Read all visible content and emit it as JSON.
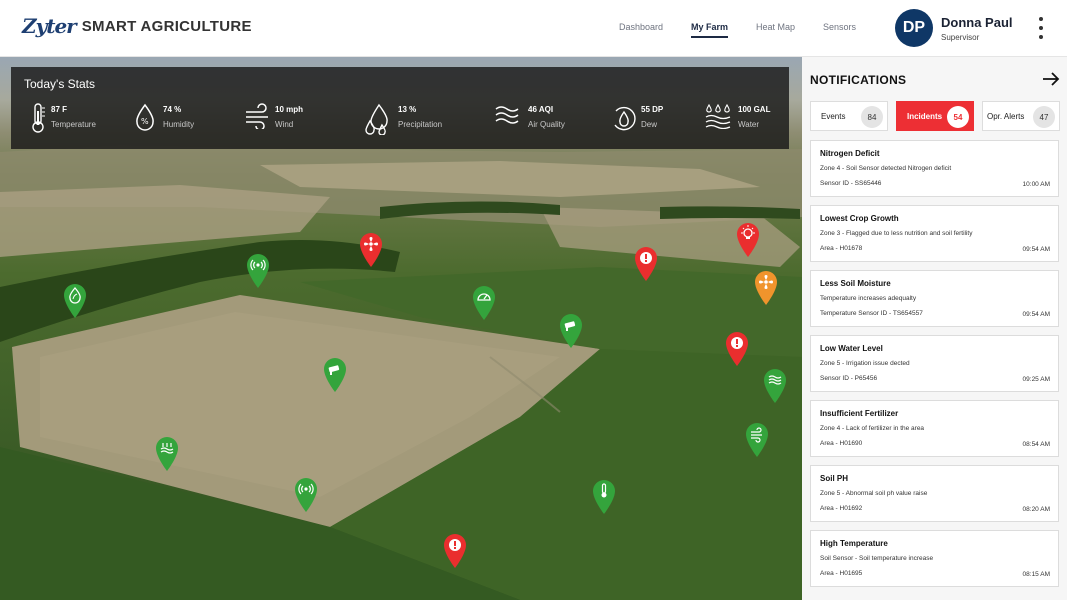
{
  "header": {
    "logo_mark": "Zyter",
    "app_title": "SMART AGRICULTURE",
    "nav": [
      "Dashboard",
      "My Farm",
      "Heat Map",
      "Sensors"
    ],
    "active_nav": "My Farm",
    "user": {
      "initials": "DP",
      "name": "Donna Paul",
      "role": "Supervisor"
    }
  },
  "stats": {
    "title": "Today's Stats",
    "items": [
      {
        "value": "87 F",
        "label": "Temperature",
        "icon": "thermometer-icon"
      },
      {
        "value": "74 %",
        "label": "Humidity",
        "icon": "humidity-drop-icon"
      },
      {
        "value": "10 mph",
        "label": "Wind",
        "icon": "wind-icon"
      },
      {
        "value": "13 %",
        "label": "Precipitation",
        "icon": "rain-drops-icon"
      },
      {
        "value": "46 AQI",
        "label": "Air Quality",
        "icon": "air-waves-icon"
      },
      {
        "value": "55 DP",
        "label": "Dew",
        "icon": "dew-icon"
      },
      {
        "value": "100 GAL",
        "label": "Water",
        "icon": "water-icon"
      }
    ]
  },
  "map_pins": [
    {
      "icon": "leaf-drop-icon",
      "color": "#34a43c"
    },
    {
      "icon": "signal-icon",
      "color": "#34a43c"
    },
    {
      "icon": "fan-icon",
      "color": "#ea2e2e"
    },
    {
      "icon": "alert-icon",
      "color": "#ea2e2e"
    },
    {
      "icon": "bulb-icon",
      "color": "#ea2e2e"
    },
    {
      "icon": "gauge-icon",
      "color": "#34a43c"
    },
    {
      "icon": "fan-icon",
      "color": "#f0942c"
    },
    {
      "icon": "camera-icon",
      "color": "#34a43c"
    },
    {
      "icon": "alert-icon",
      "color": "#ea2e2e"
    },
    {
      "icon": "camera-icon",
      "color": "#34a43c"
    },
    {
      "icon": "waves-icon",
      "color": "#34a43c"
    },
    {
      "icon": "wind-icon",
      "color": "#34a43c"
    },
    {
      "icon": "heater-icon",
      "color": "#34a43c"
    },
    {
      "icon": "signal-icon",
      "color": "#34a43c"
    },
    {
      "icon": "thermometer-icon",
      "color": "#34a43c"
    },
    {
      "icon": "alert-icon",
      "color": "#ea2e2e"
    }
  ],
  "notifications": {
    "title": "NOTIFICATIONS",
    "tabs": [
      {
        "label": "Events",
        "count": "84"
      },
      {
        "label": "Incidents",
        "count": "54"
      },
      {
        "label": "Opr. Alerts",
        "count": "47"
      }
    ],
    "active_tab": "Incidents",
    "items": [
      {
        "title": "Nitrogen Deficit",
        "desc": "Zone 4  - Soil Sensor detected Nitrogen deficit",
        "source": "Sensor ID - SS65446",
        "time": "10:00 AM"
      },
      {
        "title": "Lowest Crop Growth",
        "desc": "Zone 3 - Flagged due to less nutrition and soil fertility",
        "source": "Area -  H01678",
        "time": "09:54 AM"
      },
      {
        "title": "Less Soil Moisture",
        "desc": "Temperature increases adequalty",
        "source": "Temperature Sensor ID - TS654557",
        "time": "09:54 AM"
      },
      {
        "title": "Low Water Level",
        "desc": "Zone 5 - Irrigation issue dected",
        "source": "Sensor ID - P65456",
        "time": "09:25 AM"
      },
      {
        "title": "Insufficient Fertilizer",
        "desc": "Zone 4 - Lack of fertilizer in the area",
        "source": "Area - H01690",
        "time": "08:54 AM"
      },
      {
        "title": "Soil PH",
        "desc": "Zone 5 - Abnormal soil ph value raise",
        "source": "Area - H01692",
        "time": "08:20 AM"
      },
      {
        "title": "High Temperature",
        "desc": "Soil Sensor - Soil temperature increase",
        "source": "Area - H01695",
        "time": "08:15 AM"
      }
    ]
  }
}
